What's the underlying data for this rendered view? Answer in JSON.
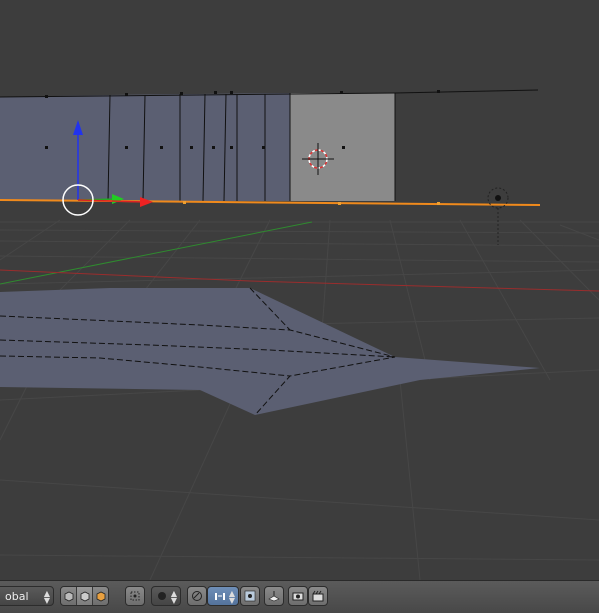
{
  "window": {
    "editor": "3D View"
  },
  "header": {
    "transform_orientation": {
      "value": "obal"
    },
    "icons": {
      "select_modes": [
        "vertex-select-icon",
        "edge-select-icon",
        "face-select-icon"
      ],
      "occlude_geometry": "limit-selection-icon",
      "pivot": "pivot-point-icon",
      "proportional": "proportional-edit-icon",
      "snap_toggle": "magnet-icon",
      "snap_element": "snap-element-icon",
      "snap_target": "snap-target-icon",
      "copy_to_layers": "layer-icon",
      "render_snapshot": "camera-icon",
      "render_anim": "clapperboard-icon"
    }
  },
  "colors": {
    "background": "#3d3d3d",
    "grid": "#4a4a4a",
    "x_axis": "#b33a3a",
    "y_axis": "#3a8a3a",
    "selected_edge": "#f08a1c",
    "mesh_face": "#5c6070",
    "selected_face": "#8e8e8e"
  }
}
